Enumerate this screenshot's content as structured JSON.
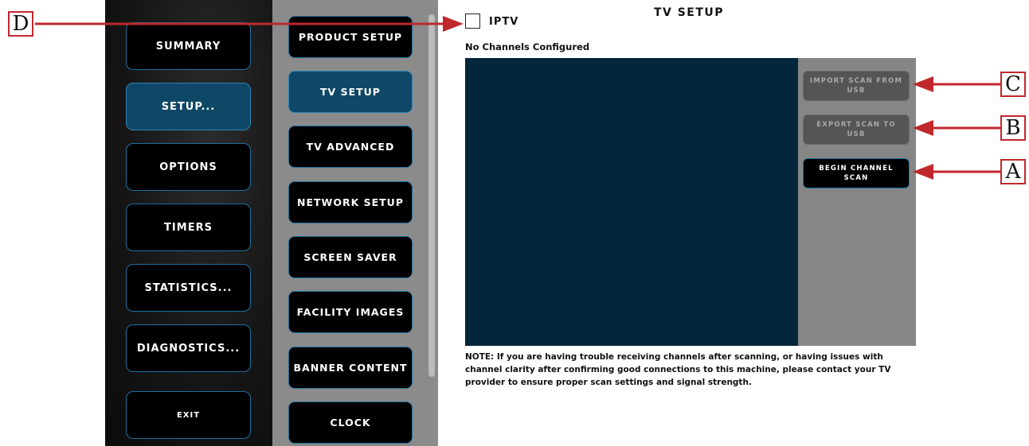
{
  "left_nav": {
    "items": [
      {
        "label": "SUMMARY",
        "active": false
      },
      {
        "label": "SETUP...",
        "active": true
      },
      {
        "label": "OPTIONS",
        "active": false
      },
      {
        "label": "TIMERS",
        "active": false
      },
      {
        "label": "STATISTICS...",
        "active": false
      },
      {
        "label": "DIAGNOSTICS...",
        "active": false
      },
      {
        "label": "EXIT",
        "active": false
      }
    ]
  },
  "sub_nav": {
    "items": [
      {
        "label": "PRODUCT SETUP",
        "active": false
      },
      {
        "label": "TV SETUP",
        "active": true
      },
      {
        "label": "TV ADVANCED",
        "active": false
      },
      {
        "label": "NETWORK SETUP",
        "active": false
      },
      {
        "label": "SCREEN SAVER",
        "active": false
      },
      {
        "label": "FACILITY IMAGES",
        "active": false
      },
      {
        "label": "BANNER CONTENT",
        "active": false
      },
      {
        "label": "CLOCK",
        "active": false
      }
    ]
  },
  "main": {
    "title": "TV SETUP",
    "iptv": {
      "label": "IPTV",
      "checked": false
    },
    "status": "No Channels Configured",
    "buttons": {
      "import": "IMPORT SCAN FROM USB",
      "export": "EXPORT SCAN TO USB",
      "scan": "BEGIN CHANNEL SCAN"
    },
    "note": "NOTE: If you are having trouble receiving channels after scanning, or having issues with channel clarity after confirming good connections to this machine, please contact your TV provider to ensure proper scan settings and signal strength."
  },
  "callouts": {
    "a": "A",
    "b": "B",
    "c": "C",
    "d": "D"
  },
  "colors": {
    "accent": "#1f6f9c",
    "active_fill": "#0f4866",
    "channel_panel": "#03263a",
    "callout_red": "#c0282d"
  }
}
